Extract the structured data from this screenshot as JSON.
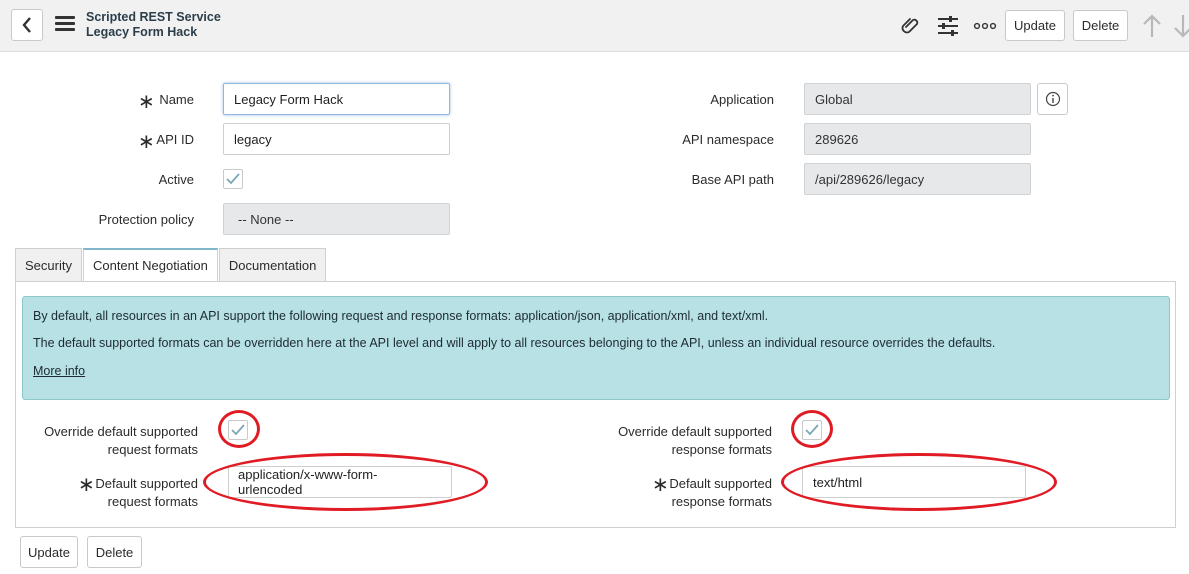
{
  "header": {
    "record_type": "Scripted REST Service",
    "record_name": "Legacy Form Hack",
    "update_label": "Update",
    "delete_label": "Delete"
  },
  "form": {
    "name": {
      "label": "Name",
      "value": "Legacy Form Hack"
    },
    "api_id": {
      "label": "API ID",
      "value": "legacy"
    },
    "active": {
      "label": "Active",
      "checked": true
    },
    "protection_policy": {
      "label": "Protection policy",
      "value": "-- None --"
    },
    "application": {
      "label": "Application",
      "value": "Global"
    },
    "api_namespace": {
      "label": "API namespace",
      "value": "289626"
    },
    "base_api_path": {
      "label": "Base API path",
      "value": "/api/289626/legacy"
    }
  },
  "tabs": [
    {
      "label": "Security",
      "active": false
    },
    {
      "label": "Content Negotiation",
      "active": true
    },
    {
      "label": "Documentation",
      "active": false
    }
  ],
  "content_negotiation": {
    "info_line1": "By default, all resources in an API support the following request and response formats: application/json, application/xml, and text/xml.",
    "info_line2": "The default supported formats can be overridden here at the API level and will apply to all resources belonging to the API, unless an individual resource overrides the defaults.",
    "more_info": "More info",
    "override_request": {
      "label_line1": "Override default supported",
      "label_line2": "request formats",
      "checked": true
    },
    "override_response": {
      "label_line1": "Override default supported",
      "label_line2": "response formats",
      "checked": true
    },
    "default_request": {
      "label_line1": "Default supported",
      "label_line2": "request formats",
      "value": "application/x-www-form-urlencoded"
    },
    "default_response": {
      "label_line1": "Default supported",
      "label_line2": "response formats",
      "value": "text/html"
    }
  },
  "footer": {
    "update_label": "Update",
    "delete_label": "Delete"
  },
  "colors": {
    "annotation_red": "#e01b24",
    "info_background": "#b7e1e4",
    "check_mark": "#7aa7b8"
  }
}
